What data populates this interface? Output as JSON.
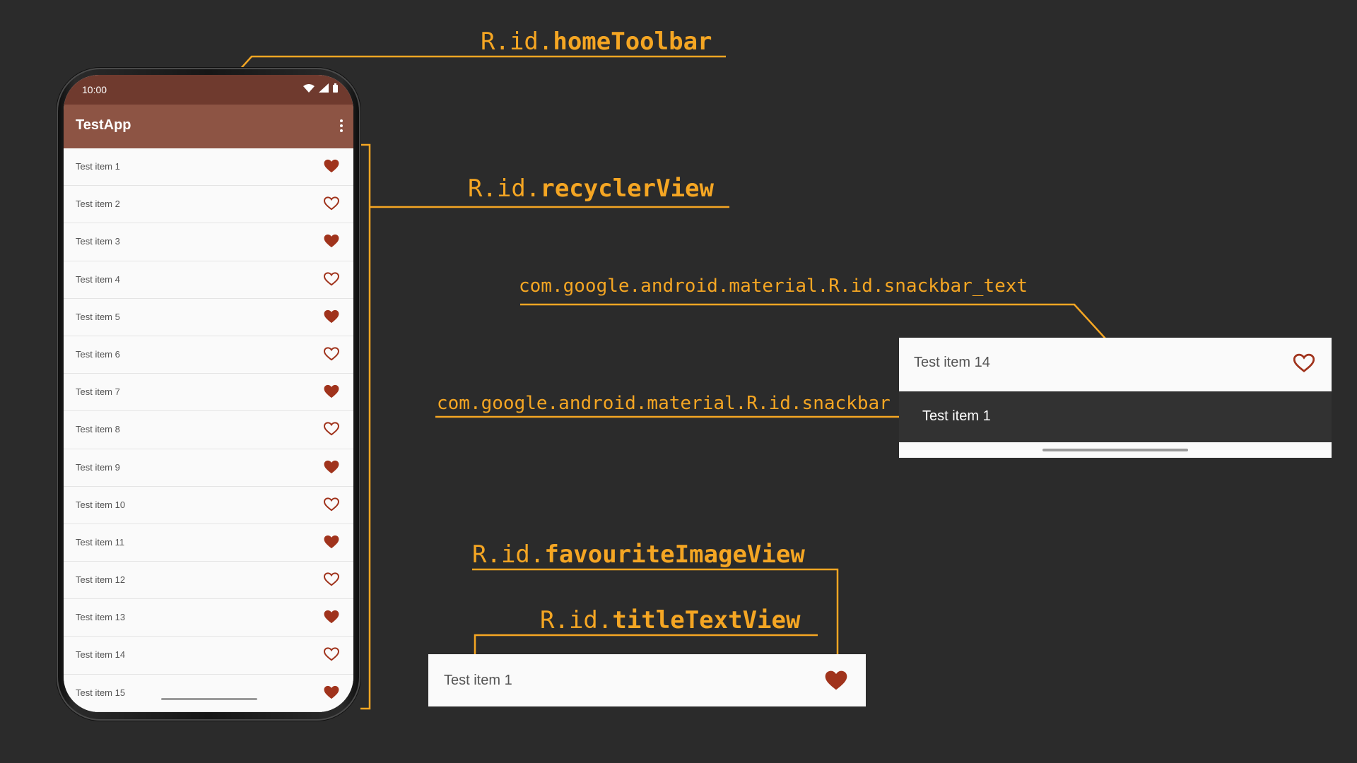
{
  "phone": {
    "status_time": "10:00",
    "app_title": "TestApp",
    "list": [
      {
        "title": "Test item 1",
        "favourite": true
      },
      {
        "title": "Test item 2",
        "favourite": false
      },
      {
        "title": "Test item 3",
        "favourite": true
      },
      {
        "title": "Test item 4",
        "favourite": false
      },
      {
        "title": "Test item 5",
        "favourite": true
      },
      {
        "title": "Test item 6",
        "favourite": false
      },
      {
        "title": "Test item 7",
        "favourite": true
      },
      {
        "title": "Test item 8",
        "favourite": false
      },
      {
        "title": "Test item 9",
        "favourite": true
      },
      {
        "title": "Test item 10",
        "favourite": false
      },
      {
        "title": "Test item 11",
        "favourite": true
      },
      {
        "title": "Test item 12",
        "favourite": false
      },
      {
        "title": "Test item 13",
        "favourite": true
      },
      {
        "title": "Test item 14",
        "favourite": false
      },
      {
        "title": "Test item 15",
        "favourite": true
      }
    ]
  },
  "labels": {
    "home_toolbar": {
      "prefix": "R.id.",
      "name": "homeToolbar"
    },
    "recycler_view": {
      "prefix": "R.id.",
      "name": "recyclerView"
    },
    "snackbar_text": "com.google.android.material.R.id.snackbar_text",
    "snackbar": "com.google.android.material.R.id.snackbar",
    "favourite_image_view": {
      "prefix": "R.id.",
      "name": "favouriteImageView"
    },
    "title_text_view": {
      "prefix": "R.id.",
      "name": "titleTextView"
    }
  },
  "snackbar_panel": {
    "row_title": "Test item 14",
    "row_favourite": false,
    "snackbar_text": "Test item 1"
  },
  "item_panel": {
    "title": "Test item 1",
    "favourite": true
  },
  "colors": {
    "background": "#2b2b2b",
    "annotation": "#f5a623",
    "toolbar": "#8d5444",
    "statusbar": "#6f3a2e",
    "heart": "#a0331c",
    "snackbar": "#323232"
  },
  "icons": {
    "favourite_filled": "heart-filled-icon",
    "favourite_outline": "heart-outline-icon",
    "overflow_menu": "more-vert-icon",
    "wifi": "wifi-icon",
    "signal": "signal-icon",
    "battery": "battery-icon"
  }
}
